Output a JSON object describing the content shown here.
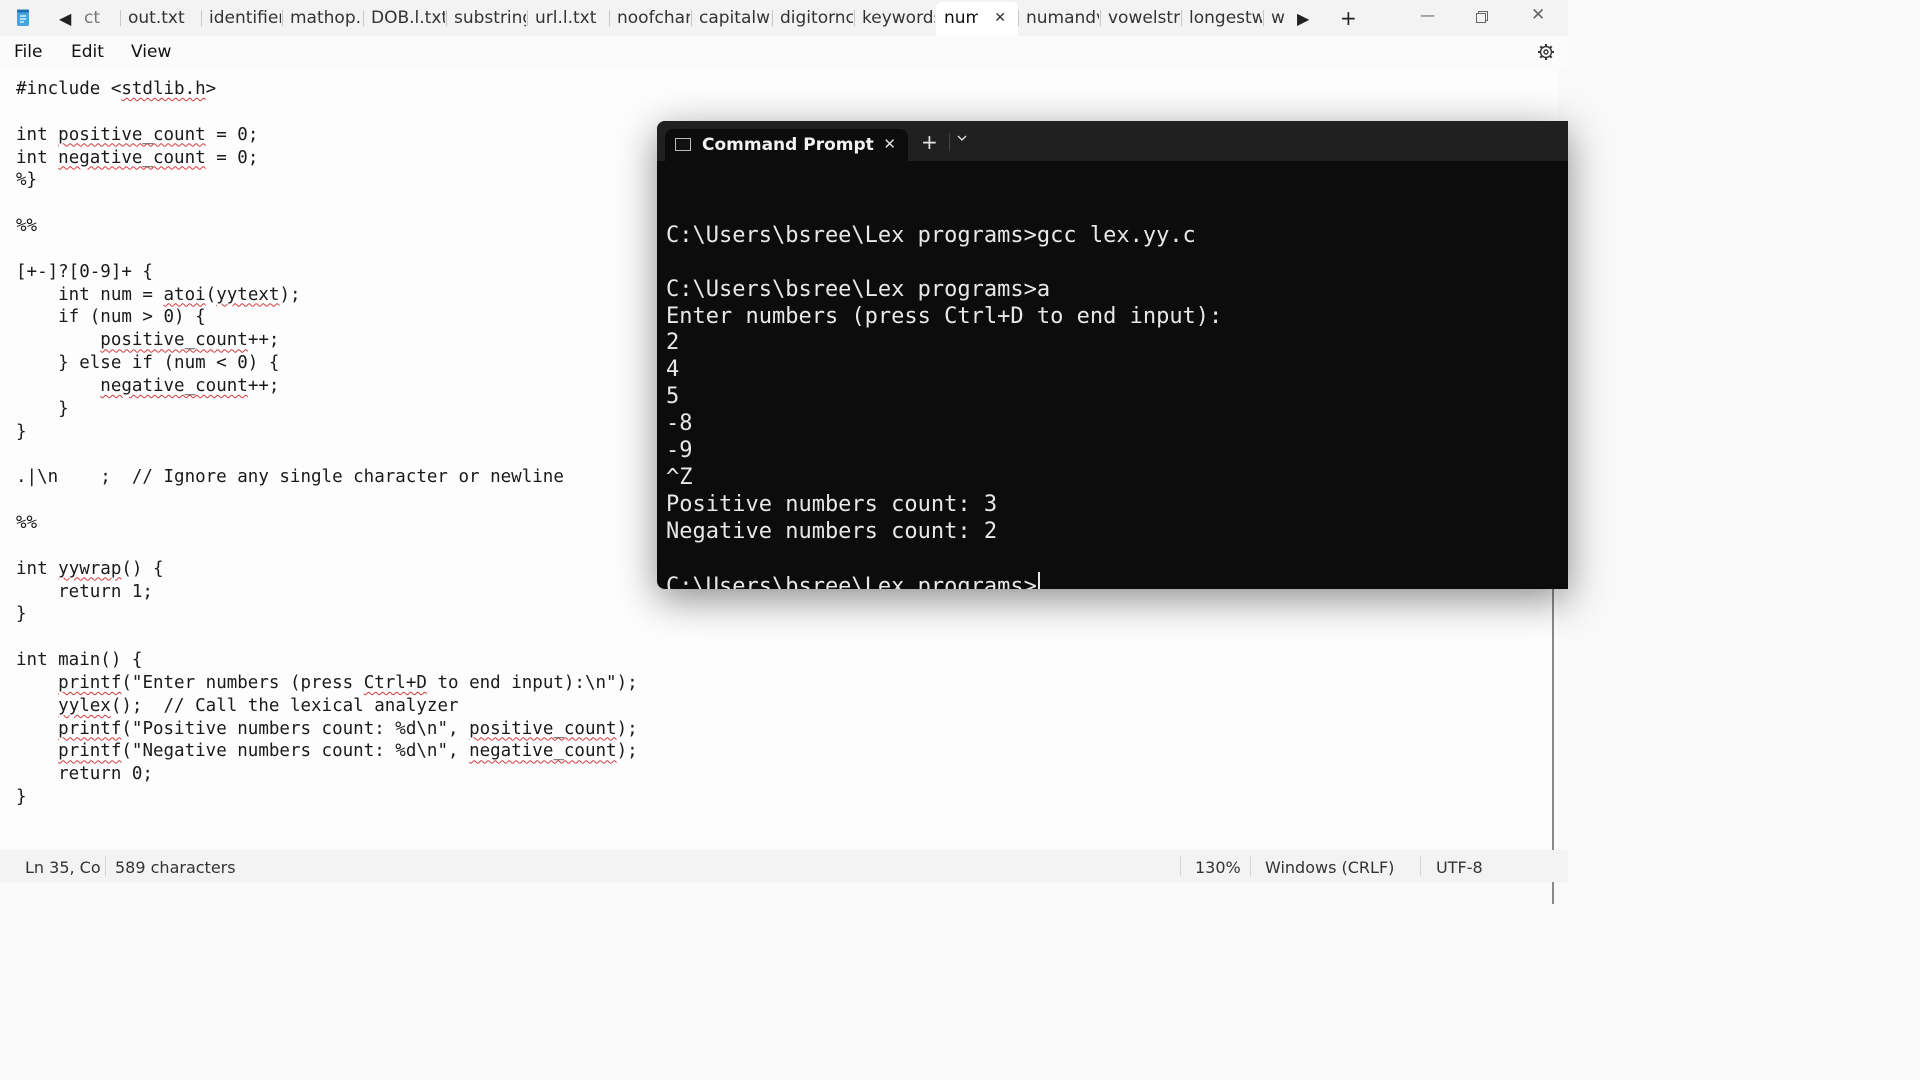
{
  "tabs": {
    "partial_left": "ct",
    "items": [
      {
        "label": "out.txt"
      },
      {
        "label": "identifier"
      },
      {
        "label": "mathop.l"
      },
      {
        "label": "DOB.l.txt"
      },
      {
        "label": "substring"
      },
      {
        "label": "url.l.txt"
      },
      {
        "label": "noofchar"
      },
      {
        "label": "capitalwo"
      },
      {
        "label": "digitornc"
      },
      {
        "label": "keywords"
      },
      {
        "label": "num"
      },
      {
        "label": "numandv"
      },
      {
        "label": "vowelstri"
      },
      {
        "label": "longestw"
      },
      {
        "label": "w"
      }
    ],
    "active_index": 10
  },
  "menu": {
    "file": "File",
    "edit": "Edit",
    "view": "View"
  },
  "editor": {
    "lines": [
      {
        "segs": [
          {
            "t": "#include <"
          },
          {
            "t": "stdlib.h",
            "sq": true
          },
          {
            "t": ">"
          }
        ]
      },
      {
        "segs": []
      },
      {
        "segs": [
          {
            "t": "int "
          },
          {
            "t": "positive_count",
            "sq": true
          },
          {
            "t": " = 0;"
          }
        ]
      },
      {
        "segs": [
          {
            "t": "int "
          },
          {
            "t": "negative_count",
            "sq": true
          },
          {
            "t": " = 0;"
          }
        ]
      },
      {
        "segs": [
          {
            "t": "%}"
          }
        ]
      },
      {
        "segs": []
      },
      {
        "segs": [
          {
            "t": "%%"
          }
        ]
      },
      {
        "segs": []
      },
      {
        "segs": [
          {
            "t": "[+-]?[0-9]+ {"
          }
        ]
      },
      {
        "segs": [
          {
            "t": "    int num = "
          },
          {
            "t": "atoi",
            "sq": true
          },
          {
            "t": "("
          },
          {
            "t": "yytext",
            "sq": true
          },
          {
            "t": ");"
          }
        ]
      },
      {
        "segs": [
          {
            "t": "    if (num > 0) {"
          }
        ]
      },
      {
        "segs": [
          {
            "t": "        "
          },
          {
            "t": "positive_count",
            "sq": true
          },
          {
            "t": "++;"
          }
        ]
      },
      {
        "segs": [
          {
            "t": "    } else if (num < 0) {"
          }
        ]
      },
      {
        "segs": [
          {
            "t": "        "
          },
          {
            "t": "negative_count",
            "sq": true
          },
          {
            "t": "++;"
          }
        ]
      },
      {
        "segs": [
          {
            "t": "    }"
          }
        ]
      },
      {
        "segs": [
          {
            "t": "}"
          }
        ]
      },
      {
        "segs": []
      },
      {
        "segs": [
          {
            "t": ".|\\n    ;  // Ignore any single character or newline"
          }
        ]
      },
      {
        "segs": []
      },
      {
        "segs": [
          {
            "t": "%%"
          }
        ]
      },
      {
        "segs": []
      },
      {
        "segs": [
          {
            "t": "int "
          },
          {
            "t": "yywrap",
            "sq": true
          },
          {
            "t": "() {"
          }
        ]
      },
      {
        "segs": [
          {
            "t": "    return 1;"
          }
        ]
      },
      {
        "segs": [
          {
            "t": "}"
          }
        ]
      },
      {
        "segs": []
      },
      {
        "segs": [
          {
            "t": "int main() {"
          }
        ]
      },
      {
        "segs": [
          {
            "t": "    "
          },
          {
            "t": "printf",
            "sq": true
          },
          {
            "t": "(\"Enter numbers (press "
          },
          {
            "t": "Ctrl+D",
            "sq": true
          },
          {
            "t": " to end input):\\n\");"
          }
        ]
      },
      {
        "segs": [
          {
            "t": "    "
          },
          {
            "t": "yylex",
            "sq": true
          },
          {
            "t": "();  // Call the lexical analyzer"
          }
        ]
      },
      {
        "segs": [
          {
            "t": "    "
          },
          {
            "t": "printf",
            "sq": true
          },
          {
            "t": "(\"Positive numbers count: %d\\n\", "
          },
          {
            "t": "positive_count",
            "sq": true
          },
          {
            "t": ");"
          }
        ]
      },
      {
        "segs": [
          {
            "t": "    "
          },
          {
            "t": "printf",
            "sq": true
          },
          {
            "t": "(\"Negative numbers count: %d\\n\", "
          },
          {
            "t": "negative_count",
            "sq": true
          },
          {
            "t": ");"
          }
        ]
      },
      {
        "segs": [
          {
            "t": "    return 0;"
          }
        ]
      },
      {
        "segs": [
          {
            "t": "}"
          }
        ]
      }
    ]
  },
  "status": {
    "position": "Ln 35, Co",
    "chars": "589 characters",
    "zoom": "130%",
    "line_ending": "Windows (CRLF)",
    "encoding": "UTF-8"
  },
  "cmd": {
    "tab_title": "Command Prompt",
    "lines": [
      "",
      "C:\\Users\\bsree\\Lex programs>gcc lex.yy.c",
      "",
      "C:\\Users\\bsree\\Lex programs>a",
      "Enter numbers (press Ctrl+D to end input):",
      "2",
      "4",
      "5",
      "-8",
      "-9",
      "^Z",
      "Positive numbers count: 3",
      "Negative numbers count: 2",
      "",
      "C:\\Users\\bsree\\Lex programs>"
    ]
  }
}
